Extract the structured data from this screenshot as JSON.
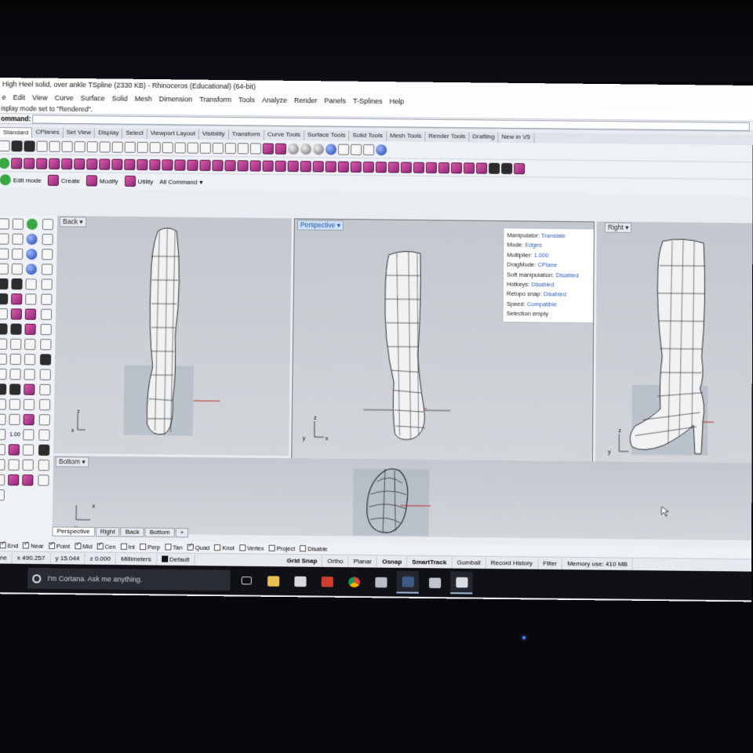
{
  "window": {
    "title": "High Heel solid, over ankle TSpline (2330 KB) - Rhinoceros (Educational) (64-bit)"
  },
  "menu": [
    "e",
    "Edit",
    "View",
    "Curve",
    "Surface",
    "Solid",
    "Mesh",
    "Dimension",
    "Transform",
    "Tools",
    "Analyze",
    "Render",
    "Panels",
    "T-Splines",
    "Help"
  ],
  "command": {
    "history": "isplay mode set to \"Rendered\".",
    "label": "ommand:",
    "value": ""
  },
  "toolbar_tabs": [
    "Standard",
    "CPlanes",
    "Set View",
    "Display",
    "Select",
    "Viewport Layout",
    "Visibility",
    "Transform",
    "Curve Tools",
    "Surface Tools",
    "Solid Tools",
    "Mesh Tools",
    "Render Tools",
    "Drafting",
    "New in V5"
  ],
  "modebar": {
    "items": [
      "Edit mode",
      "Create",
      "Modify",
      "Utility",
      "All Command"
    ]
  },
  "viewports": {
    "back": "Back",
    "perspective": "Perspective",
    "right": "Right",
    "bottom": "Bottom"
  },
  "axis": {
    "x": "x",
    "y": "y",
    "z": "z"
  },
  "tspline_info": {
    "manipulator_label": "Manipulator:",
    "manipulator": "Translate",
    "mode_label": "Mode:",
    "mode": "Edges",
    "multiplier_label": "Multiplier:",
    "multiplier": "1.000",
    "dragmode_label": "DragMode:",
    "dragmode": "CPlane",
    "soft_label": "Soft manipulation:",
    "soft": "Disabled",
    "hotkeys_label": "Hotkeys:",
    "hotkeys": "Disabled",
    "retopo_label": "Retopo snap:",
    "retopo": "Disabled",
    "speed_label": "Speed:",
    "speed": "Compatible",
    "selection": "Selection empty"
  },
  "left_toolbar": {
    "value": "1.00"
  },
  "viewport_tabs": [
    "Perspective",
    "Right",
    "Back",
    "Bottom",
    "+"
  ],
  "osnaps": [
    {
      "label": "End",
      "checked": true
    },
    {
      "label": "Near",
      "checked": true
    },
    {
      "label": "Point",
      "checked": true
    },
    {
      "label": "Mid",
      "checked": true
    },
    {
      "label": "Cen",
      "checked": true
    },
    {
      "label": "Int",
      "checked": false
    },
    {
      "label": "Perp",
      "checked": false
    },
    {
      "label": "Tan",
      "checked": false
    },
    {
      "label": "Quad",
      "checked": true
    },
    {
      "label": "Knot",
      "checked": false
    },
    {
      "label": "Vertex",
      "checked": false
    },
    {
      "label": "Project",
      "checked": false
    },
    {
      "label": "Disable",
      "checked": false
    }
  ],
  "status": {
    "cplane": "ane",
    "x": "x 490.257",
    "y": "y 15.044",
    "z": "z 0.000",
    "units": "Millimeters",
    "layer": "Default",
    "grid_snap": "Grid Snap",
    "ortho": "Ortho",
    "planar": "Planar",
    "osnap": "Osnap",
    "smarttrack": "SmartTrack",
    "gumball": "Gumball",
    "record_history": "Record History",
    "filter": "Filter",
    "memory": "Memory use: 410 MB"
  },
  "taskbar": {
    "search_placeholder": "I'm Cortana. Ask me anything."
  },
  "colors": {
    "accent": "#2e5db3",
    "viewport_bg": "#c8ccd2",
    "taskbar": "#101116"
  }
}
